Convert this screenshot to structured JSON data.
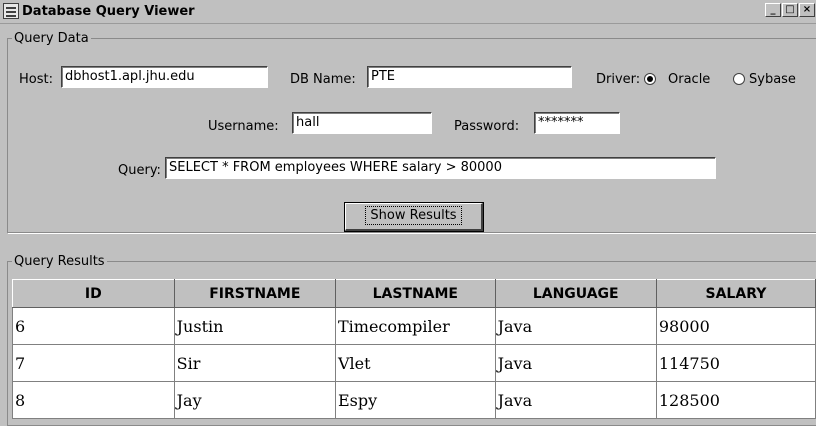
{
  "window": {
    "title": "Database Query Viewer",
    "minimize": "_",
    "maximize": "□",
    "close": "×"
  },
  "query_data": {
    "legend": "Query Data",
    "host_label": "Host:",
    "host_value": "dbhost1.apl.jhu.edu",
    "dbname_label": "DB Name:",
    "dbname_value": "PTE",
    "driver_label": "Driver:",
    "driver_options": [
      {
        "label": "Oracle",
        "selected": true
      },
      {
        "label": "Sybase",
        "selected": false
      }
    ],
    "username_label": "Username:",
    "username_value": "hall",
    "password_label": "Password:",
    "password_value": "*******",
    "query_label": "Query:",
    "query_value": "SELECT * FROM employees WHERE salary > 80000",
    "show_results_label": "Show Results"
  },
  "query_results": {
    "legend": "Query Results",
    "columns": [
      "ID",
      "FIRSTNAME",
      "LASTNAME",
      "LANGUAGE",
      "SALARY"
    ],
    "rows": [
      [
        "6",
        "Justin",
        "Timecompiler",
        "Java",
        "98000"
      ],
      [
        "7",
        "Sir",
        "Vlet",
        "Java",
        "114750"
      ],
      [
        "8",
        "Jay",
        "Espy",
        "Java",
        "128500"
      ]
    ]
  }
}
